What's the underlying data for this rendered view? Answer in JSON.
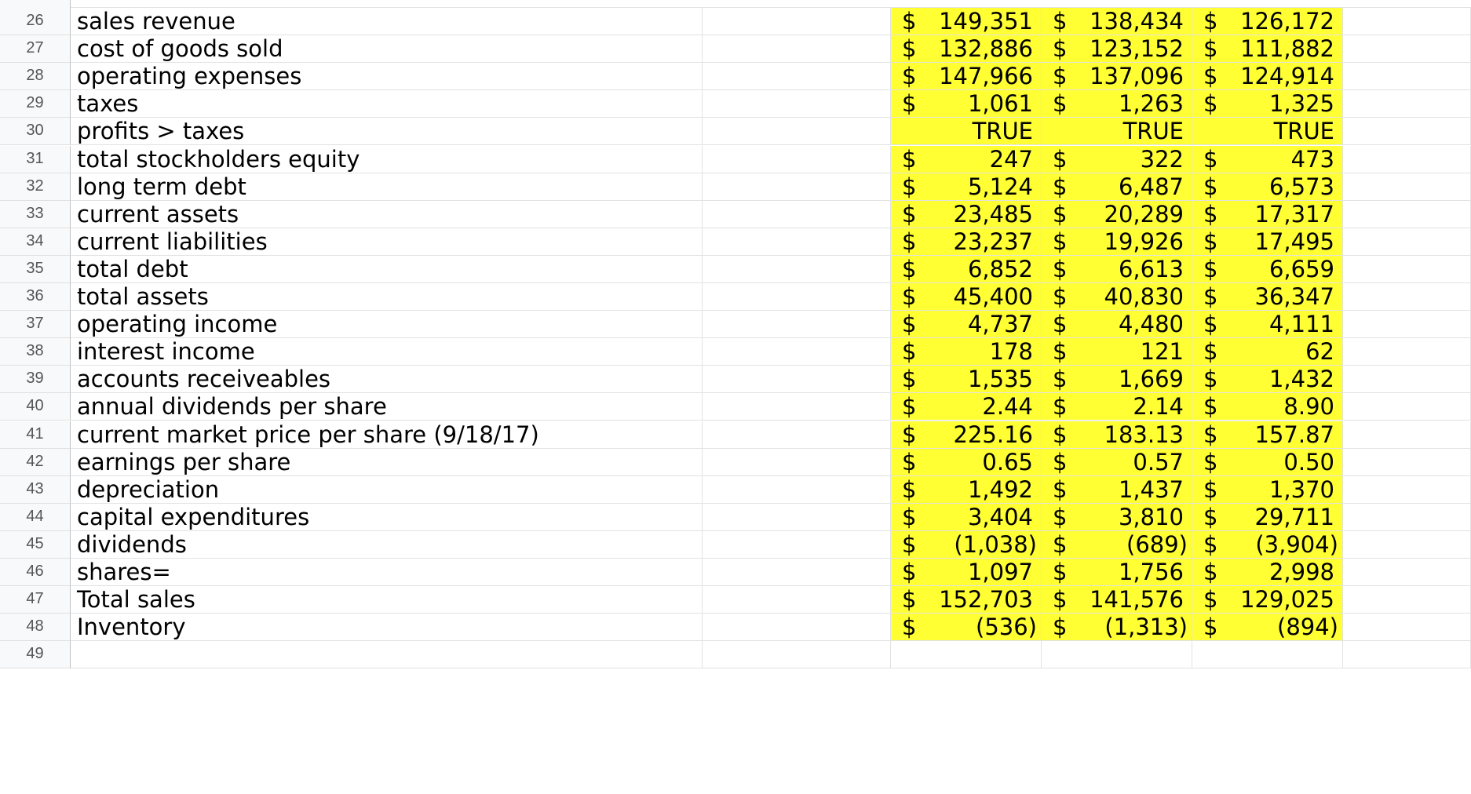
{
  "sheet": {
    "rows": [
      {
        "num": "26",
        "label": "sales revenue",
        "vals": [
          "149,351",
          "138,434",
          "126,172"
        ],
        "cur": true
      },
      {
        "num": "27",
        "label": "cost of goods sold",
        "vals": [
          "132,886",
          "123,152",
          "111,882"
        ],
        "cur": true
      },
      {
        "num": "28",
        "label": "operating expenses",
        "vals": [
          "147,966",
          "137,096",
          "124,914"
        ],
        "cur": true
      },
      {
        "num": "29",
        "label": "taxes",
        "vals": [
          "1,061",
          "1,263",
          "1,325"
        ],
        "cur": true
      },
      {
        "num": "30",
        "label": "profits > taxes",
        "vals": [
          "TRUE",
          "TRUE",
          "TRUE"
        ],
        "cur": false
      },
      {
        "num": "31",
        "label": "total stockholders equity",
        "vals": [
          "247",
          "322",
          "473"
        ],
        "cur": true
      },
      {
        "num": "32",
        "label": "long term debt",
        "vals": [
          "5,124",
          "6,487",
          "6,573"
        ],
        "cur": true
      },
      {
        "num": "33",
        "label": "current assets",
        "vals": [
          "23,485",
          "20,289",
          "17,317"
        ],
        "cur": true
      },
      {
        "num": "34",
        "label": "current liabilities",
        "vals": [
          "23,237",
          "19,926",
          "17,495"
        ],
        "cur": true
      },
      {
        "num": "35",
        "label": "total debt",
        "vals": [
          "6,852",
          "6,613",
          "6,659"
        ],
        "cur": true
      },
      {
        "num": "36",
        "label": "total assets",
        "vals": [
          "45,400",
          "40,830",
          "36,347"
        ],
        "cur": true
      },
      {
        "num": "37",
        "label": "operating income",
        "vals": [
          "4,737",
          "4,480",
          "4,111"
        ],
        "cur": true
      },
      {
        "num": "38",
        "label": "interest income",
        "vals": [
          "178",
          "121",
          "62"
        ],
        "cur": true
      },
      {
        "num": "39",
        "label": "accounts receiveables",
        "vals": [
          "1,535",
          "1,669",
          "1,432"
        ],
        "cur": true
      },
      {
        "num": "40",
        "label": "annual dividends per share",
        "vals": [
          "2.44",
          "2.14",
          "8.90"
        ],
        "cur": true
      },
      {
        "num": "41",
        "label": "current market price per share (9/18/17)",
        "vals": [
          "225.16",
          "183.13",
          "157.87"
        ],
        "cur": true
      },
      {
        "num": "42",
        "label": "earnings per share",
        "vals": [
          "0.65",
          "0.57",
          "0.50"
        ],
        "cur": true
      },
      {
        "num": "43",
        "label": "depreciation",
        "vals": [
          "1,492",
          "1,437",
          "1,370"
        ],
        "cur": true
      },
      {
        "num": "44",
        "label": "capital expenditures",
        "vals": [
          "3,404",
          "3,810",
          "29,711"
        ],
        "cur": true
      },
      {
        "num": "45",
        "label": "dividends",
        "vals": [
          "(1,038)",
          "(689)",
          "(3,904)"
        ],
        "cur": true
      },
      {
        "num": "46",
        "label": "shares=",
        "vals": [
          "1,097",
          "1,756",
          "2,998"
        ],
        "cur": true
      },
      {
        "num": "47",
        "label": "Total sales",
        "vals": [
          "152,703",
          "141,576",
          "129,025"
        ],
        "cur": true
      },
      {
        "num": "48",
        "label": "Inventory",
        "vals": [
          "(536)",
          "(1,313)",
          "(894)"
        ],
        "cur": true
      },
      {
        "num": "49",
        "label": "",
        "vals": [
          "",
          "",
          ""
        ],
        "cur": false
      }
    ],
    "currency_symbol": "$",
    "highlight_color": "#ffff33"
  }
}
